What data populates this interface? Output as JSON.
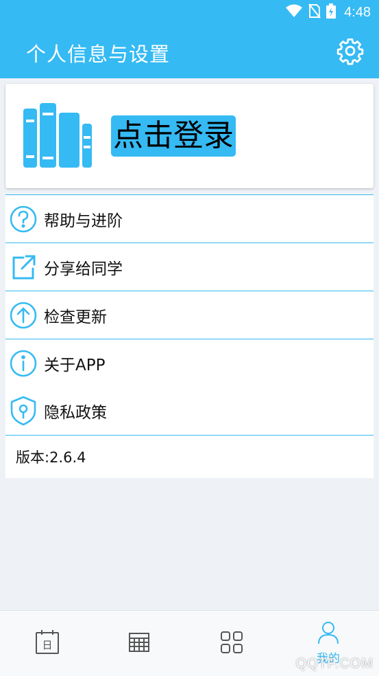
{
  "status_bar": {
    "time": "4:48"
  },
  "header": {
    "title": "个人信息与设置"
  },
  "login_card": {
    "login_label": "点击登录"
  },
  "menu": {
    "items": [
      {
        "label": "帮助与进阶",
        "icon": "help-circle-icon"
      },
      {
        "label": "分享给同学",
        "icon": "share-external-icon"
      },
      {
        "label": "检查更新",
        "icon": "arrow-up-circle-icon"
      },
      {
        "label": "关于APP",
        "icon": "info-circle-icon"
      },
      {
        "label": "隐私政策",
        "icon": "shield-lock-icon"
      }
    ],
    "version": "版本:2.6.4"
  },
  "bottom_nav": {
    "tabs": [
      {
        "icon": "calendar-day-icon",
        "label": "日"
      },
      {
        "icon": "table-grid-icon"
      },
      {
        "icon": "apps-grid-icon"
      },
      {
        "icon": "person-icon",
        "label": "我的",
        "active": true
      }
    ]
  },
  "watermark": "QQTF.COM",
  "colors": {
    "accent": "#35baf3",
    "background": "#eef2f6",
    "nav_icon": "#555555"
  }
}
